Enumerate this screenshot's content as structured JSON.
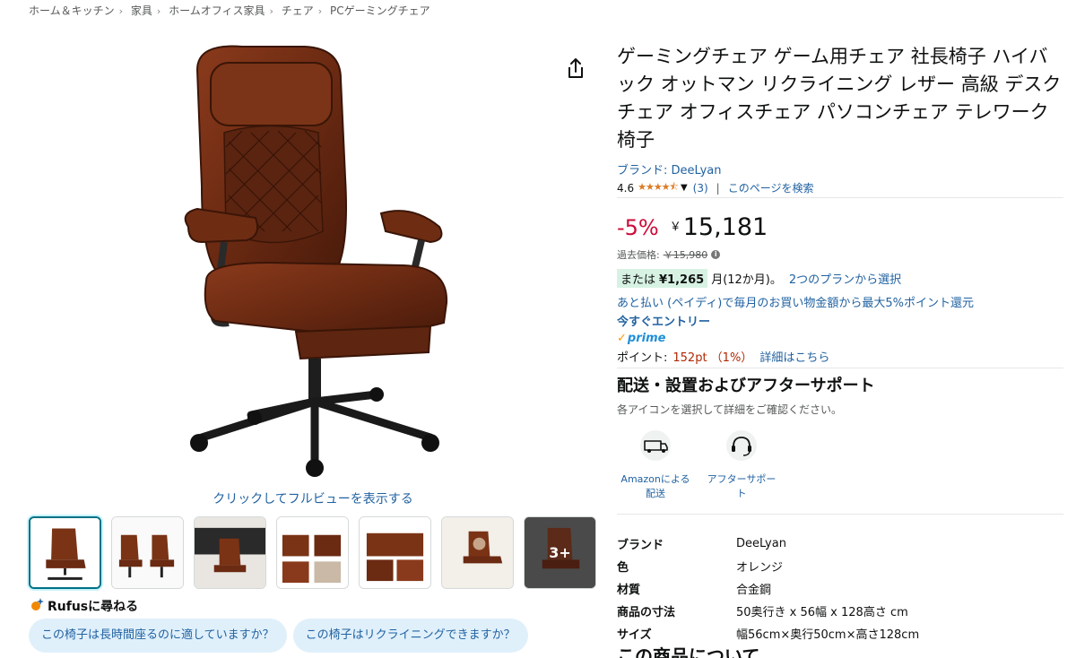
{
  "breadcrumb": [
    "ホーム＆キッチン",
    "家具",
    "ホームオフィス家具",
    "チェア",
    "PCゲーミングチェア"
  ],
  "gallery": {
    "fullview_label": "クリックしてフルビューを表示する",
    "more_label": "3+"
  },
  "rufus": {
    "heading": "Rufusに尋ねる",
    "questions": [
      "この椅子は長時間座るのに適していますか？",
      "この椅子はリクライニングできますか？"
    ]
  },
  "product": {
    "title": "ゲーミングチェア ゲーム用チェア 社長椅子 ハイバック オットマン リクライニング レザー 高級 デスクチェア オフィスチェア パソコンチェア テレワーク椅子",
    "brand_link": "ブランド: DeeLyan",
    "rating": "4.6",
    "stars": "★★★★⯪",
    "review_count": "(3)",
    "search_page": "このページを検索",
    "discount": "-5%",
    "currency": "￥",
    "price": "15,181",
    "old_price_label": "過去価格:",
    "old_price": "￥15,980",
    "installment_prefix": "または",
    "installment_amount": "¥1,265",
    "installment_suffix": "月(12か月)。",
    "installment_plans": "2つのプランから選択",
    "paidy": "あと払い (ペイディ)で毎月のお買い物金額から最大5%ポイント還元",
    "entry": "今すぐエントリー",
    "prime": "prime",
    "points_label": "ポイント:",
    "points_value": "152pt （1%）",
    "points_details": "詳細はこちら"
  },
  "delivery": {
    "heading": "配送・設置およびアフターサポート",
    "sub": "各アイコンを選択して詳細をご確認ください。",
    "icons": [
      {
        "icon": "delivery-truck-icon",
        "label": "Amazonによる配送"
      },
      {
        "icon": "headset-support-icon",
        "label": "アフターサポート"
      }
    ]
  },
  "specs": [
    {
      "k": "ブランド",
      "v": "DeeLyan"
    },
    {
      "k": "色",
      "v": "オレンジ"
    },
    {
      "k": "材質",
      "v": "合金鋼"
    },
    {
      "k": "商品の寸法",
      "v": "50奥行き x 56幅 x 128高さ cm"
    },
    {
      "k": "サイズ",
      "v": "幅56cm×奥行50cm×高さ128cm"
    }
  ],
  "about_heading": "この商品について",
  "colors": {
    "link": "#2162a1",
    "discount": "#cc0c39",
    "star": "#de7921",
    "chip_bg": "#e0f0fb",
    "installment_bg": "#d7f2e3"
  }
}
